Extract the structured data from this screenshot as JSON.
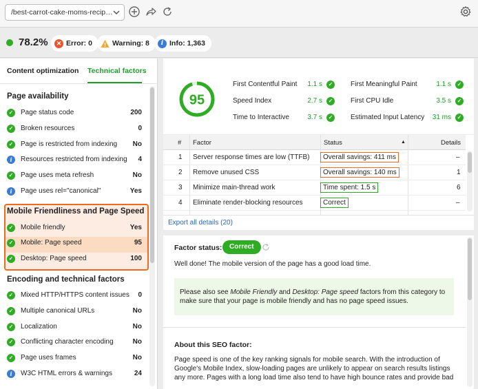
{
  "toolbar": {
    "url": "/best-carrot-cake-moms-recip…",
    "icons": [
      "chevron-down-icon",
      "add-icon",
      "share-icon",
      "refresh-icon",
      "settings-icon"
    ]
  },
  "status": {
    "score": "78.2%",
    "error": "Error: 0",
    "warning": "Warning: 8",
    "info": "Info: 1,363",
    "colors": {
      "ok": "#2eac23",
      "error": "#e8542c",
      "warning": "#f5a623",
      "info": "#3a7bd5"
    }
  },
  "tabs": [
    "Content optimization",
    "Technical factors"
  ],
  "sections": [
    {
      "title": "Page availability",
      "items": [
        {
          "icon": "check",
          "label": "Page status code",
          "value": "200"
        },
        {
          "icon": "check",
          "label": "Broken resources",
          "value": "0"
        },
        {
          "icon": "check",
          "label": "Page is restricted from indexing",
          "value": "No"
        },
        {
          "icon": "info",
          "label": "Resources restricted from indexing",
          "value": "4"
        },
        {
          "icon": "check",
          "label": "Page uses meta refresh",
          "value": "No"
        },
        {
          "icon": "info",
          "label": "Page uses rel=\"canonical\"",
          "value": "Yes"
        }
      ]
    },
    {
      "title": "Mobile Friendliness and Page Speed",
      "items": [
        {
          "icon": "check",
          "label": "Mobile friendly",
          "value": "Yes"
        },
        {
          "icon": "check",
          "label": "Mobile: Page speed",
          "value": "95"
        },
        {
          "icon": "check",
          "label": "Desktop: Page speed",
          "value": "100"
        }
      ]
    },
    {
      "title": "Encoding and technical factors",
      "items": [
        {
          "icon": "check",
          "label": "Mixed HTTP/HTTPS content issues",
          "value": "0"
        },
        {
          "icon": "check",
          "label": "Multiple canonical URLs",
          "value": "No"
        },
        {
          "icon": "check",
          "label": "Localization",
          "value": "No"
        },
        {
          "icon": "check",
          "label": "Conflicting character encoding",
          "value": "No"
        },
        {
          "icon": "check",
          "label": "Page uses frames",
          "value": "No"
        },
        {
          "icon": "info",
          "label": "W3C HTML errors & warnings",
          "value": "24"
        }
      ]
    }
  ],
  "gauge": {
    "score": "95",
    "fraction": 0.95
  },
  "metrics": [
    {
      "label": "First Contentful Paint",
      "value": "1.1 s"
    },
    {
      "label": "First Meaningful Paint",
      "value": "1.1 s"
    },
    {
      "label": "Speed Index",
      "value": "2.7 s"
    },
    {
      "label": "First CPU Idle",
      "value": "3.5 s"
    },
    {
      "label": "Time to Interactive",
      "value": "3.7 s"
    },
    {
      "label": "Estimated Input Latency",
      "value": "31 ms"
    }
  ],
  "table": {
    "headers": [
      "#",
      "Factor",
      "Status",
      "Details"
    ],
    "rows": [
      {
        "num": "1",
        "factor": "Server response times are low (TTFB)",
        "status": "Overall savings: 411 ms",
        "status_type": "orange",
        "details": "–"
      },
      {
        "num": "2",
        "factor": "Remove unused CSS",
        "status": "Overall savings: 140 ms",
        "status_type": "orange",
        "details": "1"
      },
      {
        "num": "3",
        "factor": "Minimize main-thread work",
        "status": "Time spent: 1.5 s",
        "status_type": "green",
        "details": "6"
      },
      {
        "num": "4",
        "factor": "Eliminate render-blocking resources",
        "status": "Correct",
        "status_type": "green",
        "details": "–"
      }
    ]
  },
  "export_label": "Export all details (20)",
  "factor_status": {
    "label": "Factor status:",
    "badge": "Correct",
    "message": "Well done! The mobile version of the page has a good load time."
  },
  "note": {
    "pre": "Please also see ",
    "f1": "Mobile Friendly",
    "and": " and ",
    "f2": "Desktop: Page speed",
    "post": " factors from this category to make sure that your page is mobile friendly and has no page speed issues."
  },
  "about": {
    "title": "About this SEO factor:",
    "text": "Page speed is one of the key ranking signals for mobile search. With the introduction of Google's Mobile Index, slow-loading pages are unlikely to appear on search results listings any more. Pages with a long load time also tend to have high bounce rates and provide bad"
  }
}
